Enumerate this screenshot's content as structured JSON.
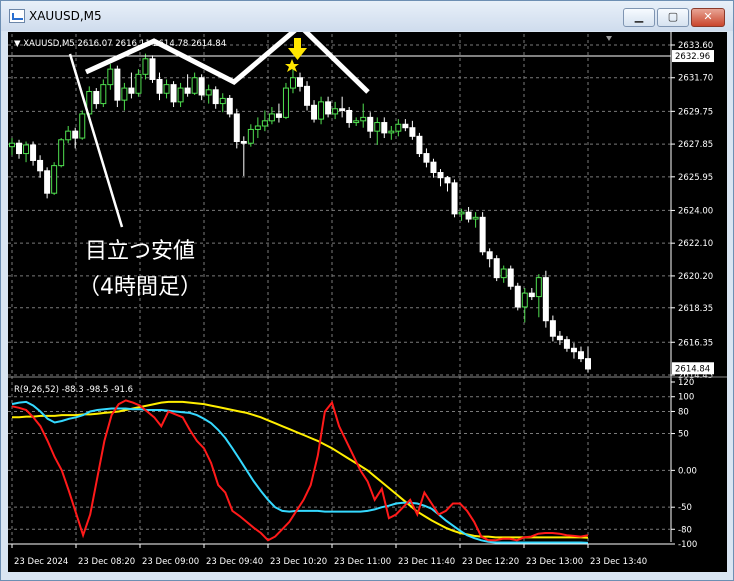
{
  "window": {
    "title": "XAUUSD,M5",
    "minimize_icon": "minimize-icon",
    "maximize_icon": "maximize-icon",
    "close_icon": "close-icon"
  },
  "chart_header": {
    "label": "▼ XAUUSD,M5  2616.07 2616.11 2614.78 2614.84"
  },
  "annotation": {
    "line1": "目立つ安値",
    "line2": "（4時間足）"
  },
  "colors": {
    "bull": "#50e050",
    "bear": "#ffffff",
    "grid": "#7a7a7a",
    "indicator_red": "#ff1a1a",
    "indicator_cyan": "#35d9ff",
    "indicator_yellow": "#ffee00",
    "arrow": "#ffe600"
  },
  "price_axis": {
    "ticks": [
      "2633.60",
      "2631.70",
      "2629.75",
      "2627.85",
      "2625.95",
      "2624.00",
      "2622.10",
      "2620.20",
      "2618.35",
      "2616.35",
      "2614.45"
    ],
    "current_price_label": "2614.84",
    "line_price_label": "2632.96"
  },
  "time_axis": {
    "ticks": [
      "23 Dec 2024",
      "23 Dec 08:20",
      "23 Dec 09:00",
      "23 Dec 09:40",
      "23 Dec 10:20",
      "23 Dec 11:00",
      "23 Dec 11:40",
      "23 Dec 12:20",
      "23 Dec 13:00",
      "23 Dec 13:40"
    ]
  },
  "indicator": {
    "label": "R(9,26,52) -88.3 -98.5 -91.6",
    "axis_ticks": [
      "120",
      "100",
      "80",
      "50",
      "0.00",
      "-50",
      "-80",
      "-100"
    ]
  },
  "chart_data": {
    "type": "candlestick",
    "symbol": "XAUUSD",
    "timeframe": "M5",
    "ohlc": [
      [
        2627.7,
        2628.2,
        2627.2,
        2627.9
      ],
      [
        2627.9,
        2628.1,
        2627.0,
        2627.3
      ],
      [
        2627.3,
        2628.0,
        2626.8,
        2627.8
      ],
      [
        2627.8,
        2628.0,
        2626.6,
        2626.9
      ],
      [
        2626.9,
        2627.2,
        2625.9,
        2626.3
      ],
      [
        2626.3,
        2626.5,
        2624.7,
        2625.0
      ],
      [
        2625.0,
        2626.8,
        2624.9,
        2626.6
      ],
      [
        2626.6,
        2628.2,
        2626.5,
        2628.1
      ],
      [
        2628.1,
        2628.9,
        2627.9,
        2628.6
      ],
      [
        2628.6,
        2628.8,
        2627.6,
        2628.2
      ],
      [
        2628.2,
        2629.8,
        2628.1,
        2629.6
      ],
      [
        2629.6,
        2631.2,
        2629.4,
        2630.9
      ],
      [
        2630.9,
        2631.1,
        2629.9,
        2630.2
      ],
      [
        2630.2,
        2631.6,
        2630.0,
        2631.3
      ],
      [
        2631.3,
        2632.5,
        2631.0,
        2632.2
      ],
      [
        2632.2,
        2632.4,
        2630.0,
        2630.4
      ],
      [
        2630.4,
        2631.4,
        2629.8,
        2631.1
      ],
      [
        2631.1,
        2632.0,
        2630.5,
        2630.8
      ],
      [
        2630.8,
        2632.2,
        2630.6,
        2631.9
      ],
      [
        2631.9,
        2633.1,
        2631.6,
        2632.8
      ],
      [
        2632.8,
        2633.0,
        2631.4,
        2631.6
      ],
      [
        2631.6,
        2632.0,
        2630.4,
        2630.8
      ],
      [
        2630.8,
        2631.6,
        2630.5,
        2631.3
      ],
      [
        2631.3,
        2631.5,
        2630.0,
        2630.3
      ],
      [
        2630.3,
        2631.4,
        2630.0,
        2631.1
      ],
      [
        2631.1,
        2631.9,
        2630.6,
        2630.8
      ],
      [
        2630.8,
        2632.0,
        2630.7,
        2631.7
      ],
      [
        2631.7,
        2631.9,
        2630.4,
        2630.7
      ],
      [
        2630.7,
        2631.3,
        2630.2,
        2631.0
      ],
      [
        2631.0,
        2631.2,
        2629.9,
        2630.2
      ],
      [
        2630.2,
        2630.8,
        2629.7,
        2630.5
      ],
      [
        2630.5,
        2630.7,
        2629.4,
        2629.6
      ],
      [
        2629.6,
        2629.9,
        2627.6,
        2628.0
      ],
      [
        2628.0,
        2628.3,
        2626.0,
        2627.9
      ],
      [
        2627.9,
        2629.0,
        2627.7,
        2628.7
      ],
      [
        2628.7,
        2629.4,
        2628.2,
        2628.9
      ],
      [
        2628.9,
        2629.8,
        2628.6,
        2629.2
      ],
      [
        2629.2,
        2630.0,
        2629.0,
        2629.6
      ],
      [
        2629.6,
        2630.2,
        2629.1,
        2629.4
      ],
      [
        2629.4,
        2631.4,
        2629.3,
        2631.1
      ],
      [
        2631.1,
        2632.6,
        2630.8,
        2631.7
      ],
      [
        2631.7,
        2632.0,
        2630.9,
        2631.2
      ],
      [
        2631.2,
        2631.5,
        2629.8,
        2630.1
      ],
      [
        2630.1,
        2630.4,
        2629.1,
        2629.3
      ],
      [
        2629.3,
        2630.6,
        2629.0,
        2630.3
      ],
      [
        2630.3,
        2630.6,
        2629.4,
        2629.6
      ],
      [
        2629.6,
        2630.3,
        2629.3,
        2629.9
      ],
      [
        2629.9,
        2630.6,
        2629.4,
        2629.8
      ],
      [
        2629.8,
        2630.0,
        2628.8,
        2629.1
      ],
      [
        2629.1,
        2629.4,
        2628.9,
        2629.2
      ],
      [
        2629.2,
        2630.2,
        2628.8,
        2629.4
      ],
      [
        2629.4,
        2629.7,
        2628.2,
        2628.6
      ],
      [
        2628.6,
        2629.4,
        2627.8,
        2629.1
      ],
      [
        2629.1,
        2629.4,
        2628.2,
        2628.5
      ],
      [
        2628.5,
        2628.9,
        2628.1,
        2628.6
      ],
      [
        2628.6,
        2629.3,
        2628.3,
        2629.0
      ],
      [
        2629.0,
        2629.3,
        2628.6,
        2628.8
      ],
      [
        2628.8,
        2629.2,
        2628.1,
        2628.3
      ],
      [
        2628.3,
        2628.5,
        2627.1,
        2627.3
      ],
      [
        2627.3,
        2627.6,
        2626.5,
        2626.8
      ],
      [
        2626.8,
        2627.0,
        2625.9,
        2626.2
      ],
      [
        2626.2,
        2626.4,
        2625.4,
        2625.9
      ],
      [
        2625.9,
        2626.0,
        2625.1,
        2625.6
      ],
      [
        2625.6,
        2625.8,
        2623.6,
        2623.8
      ],
      [
        2623.8,
        2624.1,
        2623.4,
        2623.9
      ],
      [
        2623.9,
        2624.2,
        2623.3,
        2623.5
      ],
      [
        2623.5,
        2623.9,
        2623.0,
        2623.6
      ],
      [
        2623.6,
        2623.9,
        2621.4,
        2621.6
      ],
      [
        2621.6,
        2621.8,
        2620.7,
        2621.2
      ],
      [
        2621.2,
        2621.4,
        2619.9,
        2620.1
      ],
      [
        2620.1,
        2620.8,
        2619.8,
        2620.6
      ],
      [
        2620.6,
        2620.8,
        2619.4,
        2619.6
      ],
      [
        2619.6,
        2619.8,
        2618.2,
        2618.4
      ],
      [
        2618.4,
        2619.5,
        2617.5,
        2619.2
      ],
      [
        2619.2,
        2619.5,
        2618.8,
        2619.0
      ],
      [
        2619.0,
        2620.3,
        2617.8,
        2620.1
      ],
      [
        2620.1,
        2620.5,
        2617.2,
        2617.6
      ],
      [
        2617.6,
        2617.9,
        2616.4,
        2616.7
      ],
      [
        2616.7,
        2617.0,
        2616.2,
        2616.5
      ],
      [
        2616.5,
        2616.7,
        2615.8,
        2616.0
      ],
      [
        2616.0,
        2616.3,
        2615.4,
        2615.8
      ],
      [
        2615.8,
        2616.1,
        2615.2,
        2615.4
      ],
      [
        2615.4,
        2616.1,
        2614.6,
        2614.8
      ]
    ],
    "indicator_series": [
      {
        "values": [
          87,
          85,
          82,
          72,
          60,
          40,
          18,
          0,
          -28,
          -58,
          -88,
          -60,
          -10,
          40,
          75,
          90,
          95,
          92,
          88,
          80,
          72,
          60,
          80,
          76,
          72,
          55,
          40,
          30,
          10,
          -20,
          -30,
          -55,
          -62,
          -70,
          -78,
          -85,
          -95,
          -90,
          -80,
          -70,
          -55,
          -40,
          -20,
          20,
          80,
          92,
          60,
          40,
          20,
          0,
          -15,
          -40,
          -25,
          -65,
          -60,
          -50,
          -40,
          -60,
          -30,
          -45,
          -60,
          -55,
          -45,
          -45,
          -55,
          -70,
          -90,
          -95,
          -95,
          -93,
          -93,
          -95,
          -91,
          -90,
          -86,
          -85,
          -85,
          -86,
          -88,
          -89,
          -90,
          -88
        ]
      },
      {
        "values": [
          90,
          92,
          93,
          88,
          80,
          70,
          65,
          67,
          70,
          72,
          75,
          80,
          82,
          83,
          84,
          84,
          84,
          83,
          83,
          82,
          82,
          82,
          81,
          80,
          79,
          78,
          75,
          70,
          64,
          55,
          44,
          30,
          15,
          0,
          -15,
          -28,
          -40,
          -50,
          -55,
          -56,
          -55,
          -55,
          -55,
          -55,
          -56,
          -56,
          -56,
          -56,
          -56,
          -56,
          -55,
          -53,
          -50,
          -48,
          -45,
          -44,
          -44,
          -45,
          -48,
          -52,
          -60,
          -68,
          -75,
          -82,
          -88,
          -92,
          -95,
          -97,
          -98,
          -98,
          -98,
          -98,
          -98,
          -98,
          -98,
          -98,
          -98,
          -98,
          -98,
          -98,
          -98,
          -98.5
        ]
      },
      {
        "values": [
          72,
          72,
          73,
          73,
          74,
          74,
          74,
          75,
          75,
          75,
          76,
          76,
          77,
          78,
          79,
          80,
          82,
          84,
          86,
          88,
          90,
          92,
          93,
          93,
          93,
          92,
          91,
          90,
          88,
          86,
          84,
          82,
          80,
          78,
          75,
          72,
          68,
          64,
          60,
          56,
          52,
          48,
          44,
          40,
          35,
          30,
          24,
          18,
          12,
          6,
          0,
          -8,
          -16,
          -24,
          -32,
          -40,
          -48,
          -56,
          -62,
          -68,
          -73,
          -78,
          -82,
          -85,
          -87,
          -89,
          -90,
          -90,
          -91,
          -91,
          -91,
          -91,
          -91,
          -91,
          -91,
          -91,
          -91,
          -91,
          -91,
          -91,
          -91,
          -91.6
        ]
      }
    ],
    "horizontal_line": 2632.96,
    "current_price": 2614.84
  }
}
